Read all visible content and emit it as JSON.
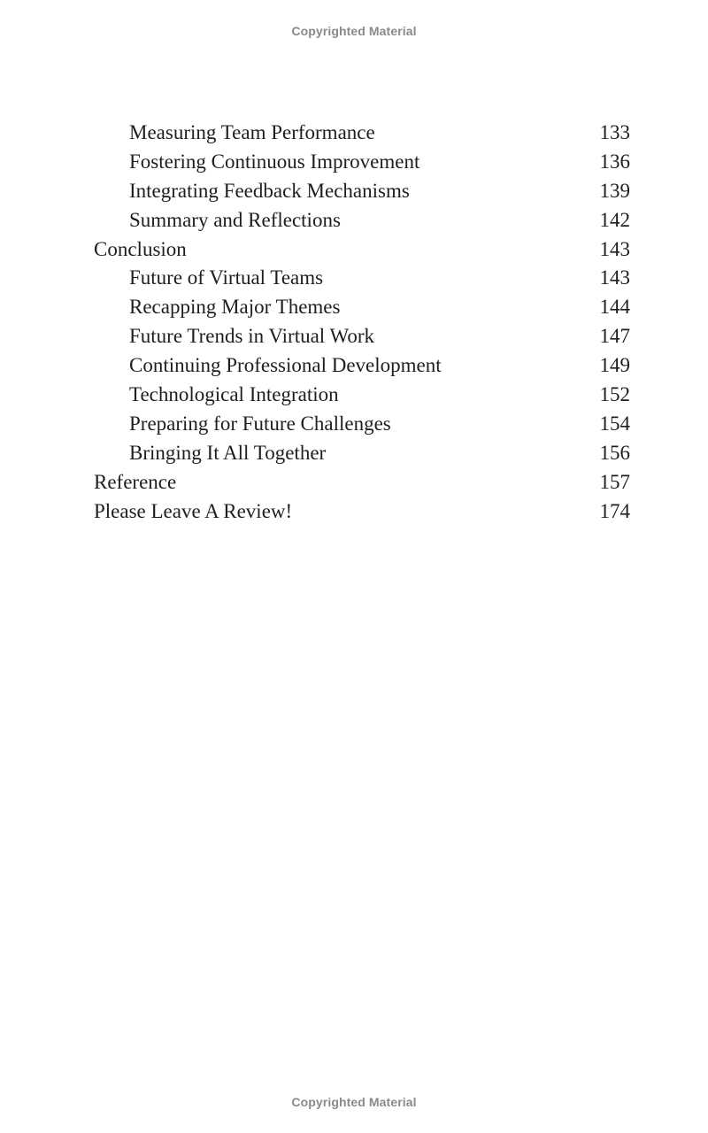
{
  "watermark": {
    "top": "Copyrighted Material",
    "bottom": "Copyrighted Material"
  },
  "toc": {
    "entries": [
      {
        "title": "Measuring Team Performance",
        "page": "133",
        "level": 2
      },
      {
        "title": "Fostering Continuous Improvement",
        "page": "136",
        "level": 2
      },
      {
        "title": "Integrating Feedback Mechanisms",
        "page": "139",
        "level": 2
      },
      {
        "title": "Summary and Reflections",
        "page": "142",
        "level": 2
      },
      {
        "title": "Conclusion",
        "page": "143",
        "level": 1
      },
      {
        "title": "Future of Virtual Teams",
        "page": "143",
        "level": 2
      },
      {
        "title": "Recapping Major Themes",
        "page": "144",
        "level": 2
      },
      {
        "title": "Future Trends in Virtual Work",
        "page": "147",
        "level": 2
      },
      {
        "title": "Continuing Professional Development",
        "page": "149",
        "level": 2
      },
      {
        "title": "Technological Integration",
        "page": "152",
        "level": 2
      },
      {
        "title": "Preparing for Future Challenges",
        "page": "154",
        "level": 2
      },
      {
        "title": "Bringing It All Together",
        "page": "156",
        "level": 2
      },
      {
        "title": "Reference",
        "page": "157",
        "level": 1
      },
      {
        "title": "Please Leave A Review!",
        "page": "174",
        "level": 1
      }
    ]
  }
}
